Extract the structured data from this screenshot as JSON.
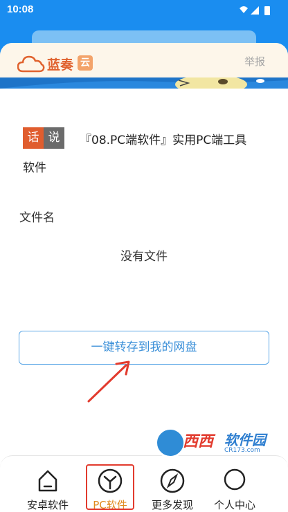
{
  "status_bar": {
    "time": "10:08"
  },
  "header": {
    "logo_text": "蓝奏",
    "logo_badge": "云",
    "report": "举报"
  },
  "share": {
    "tag_left": "话",
    "tag_right": "说",
    "title_line1": "『08.PC端软件』实用PC端工具",
    "title_line2": "软件"
  },
  "files": {
    "label": "文件名",
    "empty_message": "没有文件"
  },
  "save_button": "一键转存到我的网盘",
  "nav": {
    "items": [
      {
        "label": "安卓软件"
      },
      {
        "label": "PC软件"
      },
      {
        "label": "更多发现"
      },
      {
        "label": "个人中心"
      }
    ],
    "active_index": 1
  },
  "watermark": {
    "main": "西西",
    "secondary": "软件园",
    "sub": "CR173.com"
  },
  "colors": {
    "primary": "#1a8df0",
    "accent_orange": "#e05d2e",
    "highlight_red": "#e23b2e",
    "active_label": "#e08a1e"
  }
}
